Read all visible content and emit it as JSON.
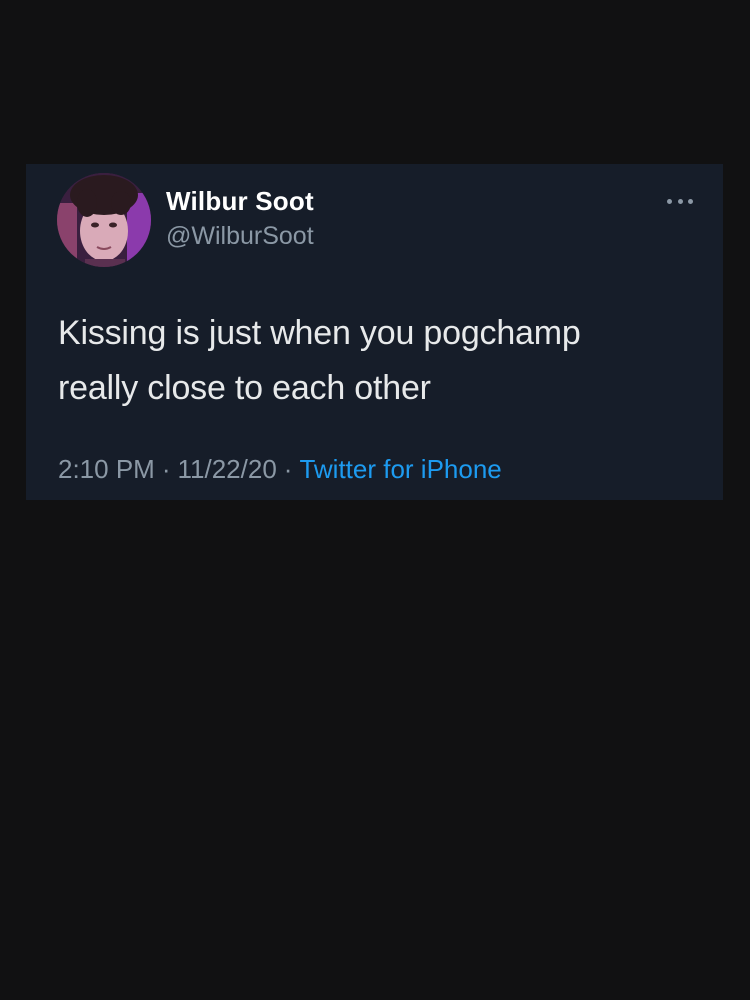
{
  "tweet": {
    "author": {
      "display_name": "Wilbur Soot",
      "handle": "@WilburSoot"
    },
    "text_lines": [
      "Kissing is just when you pogchamp",
      "really close to each other"
    ],
    "time": "2:10 PM",
    "date": "11/22/20",
    "separator": "·",
    "source": "Twitter for iPhone"
  },
  "icons": {
    "more": "more-options-icon",
    "avatar": "avatar"
  },
  "colors": {
    "page_background": "#111112",
    "card_background": "#161d29",
    "primary_text": "#e7e9ea",
    "secondary_text": "#8b98a5",
    "link": "#1d9bf0"
  }
}
